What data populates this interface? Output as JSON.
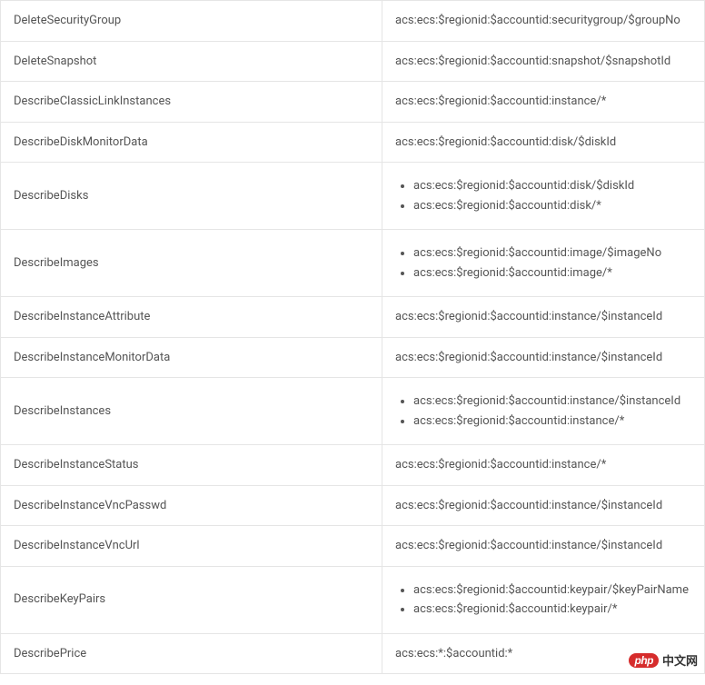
{
  "rows": [
    {
      "action": "DeleteSecurityGroup",
      "resources": [
        "acs:ecs:$regionid:$accountid:securitygroup/$groupNo"
      ],
      "list": false
    },
    {
      "action": "DeleteSnapshot",
      "resources": [
        "acs:ecs:$regionid:$accountid:snapshot/$snapshotId"
      ],
      "list": false
    },
    {
      "action": "DescribeClassicLinkInstances",
      "resources": [
        "acs:ecs:$regionid:$accountid:instance/*"
      ],
      "list": false
    },
    {
      "action": "DescribeDiskMonitorData",
      "resources": [
        "acs:ecs:$regionid:$accountid:disk/$diskId"
      ],
      "list": false
    },
    {
      "action": "DescribeDisks",
      "resources": [
        "acs:ecs:$regionid:$accountid:disk/$diskId",
        "acs:ecs:$regionid:$accountid:disk/*"
      ],
      "list": true
    },
    {
      "action": "DescribeImages",
      "resources": [
        "acs:ecs:$regionid:$accountid:image/$imageNo",
        "acs:ecs:$regionid:$accountid:image/*"
      ],
      "list": true
    },
    {
      "action": "DescribeInstanceAttribute",
      "resources": [
        "acs:ecs:$regionid:$accountid:instance/$instanceId"
      ],
      "list": false
    },
    {
      "action": "DescribeInstanceMonitorData",
      "resources": [
        "acs:ecs:$regionid:$accountid:instance/$instanceId"
      ],
      "list": false
    },
    {
      "action": "DescribeInstances",
      "resources": [
        "acs:ecs:$regionid:$accountid:instance/$instanceId",
        "acs:ecs:$regionid:$accountid:instance/*"
      ],
      "list": true
    },
    {
      "action": "DescribeInstanceStatus",
      "resources": [
        "acs:ecs:$regionid:$accountid:instance/*"
      ],
      "list": false
    },
    {
      "action": "DescribeInstanceVncPasswd",
      "resources": [
        "acs:ecs:$regionid:$accountid:instance/$instanceId"
      ],
      "list": false
    },
    {
      "action": "DescribeInstanceVncUrl",
      "resources": [
        "acs:ecs:$regionid:$accountid:instance/$instanceId"
      ],
      "list": false
    },
    {
      "action": "DescribeKeyPairs",
      "resources": [
        "acs:ecs:$regionid:$accountid:keypair/$keyPairName",
        "acs:ecs:$regionid:$accountid:keypair/*"
      ],
      "list": true
    },
    {
      "action": "DescribePrice",
      "resources": [
        "acs:ecs:*:$accountid:*"
      ],
      "list": false
    }
  ],
  "watermark": {
    "logo": "php",
    "text": "中文网"
  }
}
